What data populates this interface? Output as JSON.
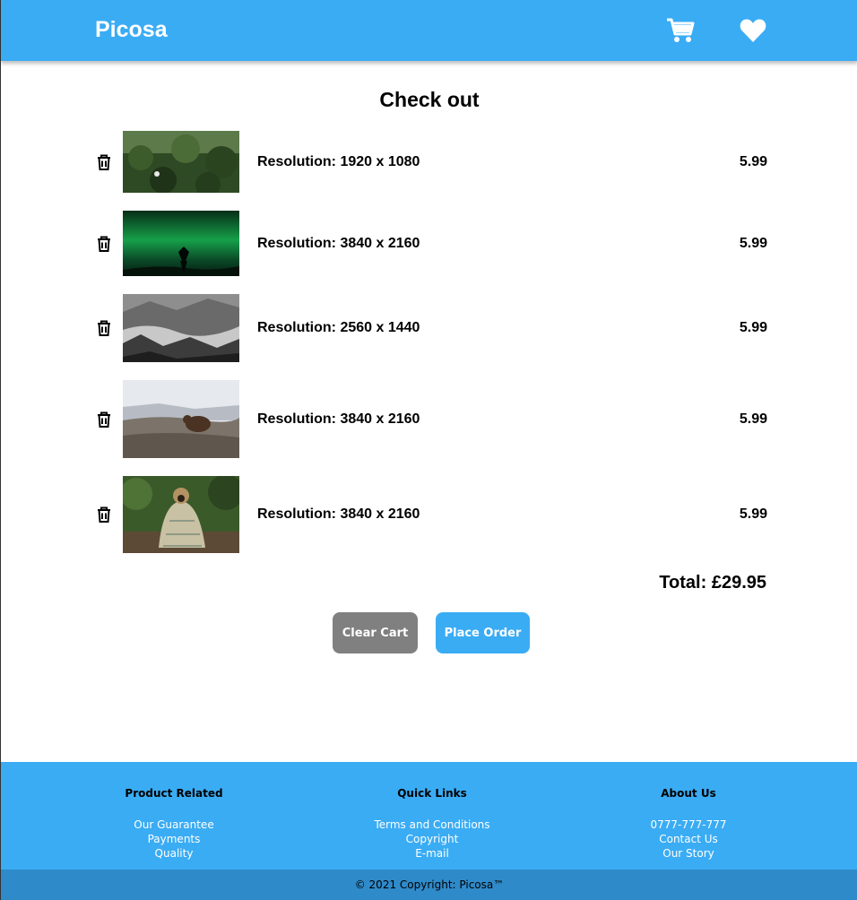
{
  "brand": "Picosa",
  "header": {
    "cart_icon": "shopping-cart-icon",
    "heart_icon": "heart-icon"
  },
  "page_title": "Check out",
  "cart_items": [
    {
      "resolution": "Resolution: 1920 x 1080",
      "price": "5.99",
      "thumbnail": "forest-hillside-photo"
    },
    {
      "resolution": "Resolution: 3840 x 2160",
      "price": "5.99",
      "thumbnail": "aurora-night-photo"
    },
    {
      "resolution": "Resolution: 2560 x 1440",
      "price": "5.99",
      "thumbnail": "misty-mountains-bw-photo"
    },
    {
      "resolution": "Resolution: 3840 x 2160",
      "price": "5.99",
      "thumbnail": "marmot-snow-photo"
    },
    {
      "resolution": "Resolution: 3840 x 2160",
      "price": "5.99",
      "thumbnail": "pug-in-blanket-photo"
    }
  ],
  "total": "Total: £29.95",
  "buttons": {
    "clear": "Clear Cart",
    "order": "Place Order"
  },
  "colors": {
    "primary": "#3aacf4",
    "footer_bar": "#2f8ac9",
    "clear_button": "#808080"
  },
  "footer": {
    "columns": [
      {
        "heading": "Product Related",
        "links": [
          "Our Guarantee",
          "Payments",
          "Quality"
        ]
      },
      {
        "heading": "Quick Links",
        "links": [
          "Terms and Conditions",
          "Copyright",
          "E-mail"
        ]
      },
      {
        "heading": "About Us",
        "links": [
          "0777-777-777",
          "Contact Us",
          "Our Story"
        ]
      }
    ],
    "copyright": "© 2021 Copyright: Picosa™"
  }
}
